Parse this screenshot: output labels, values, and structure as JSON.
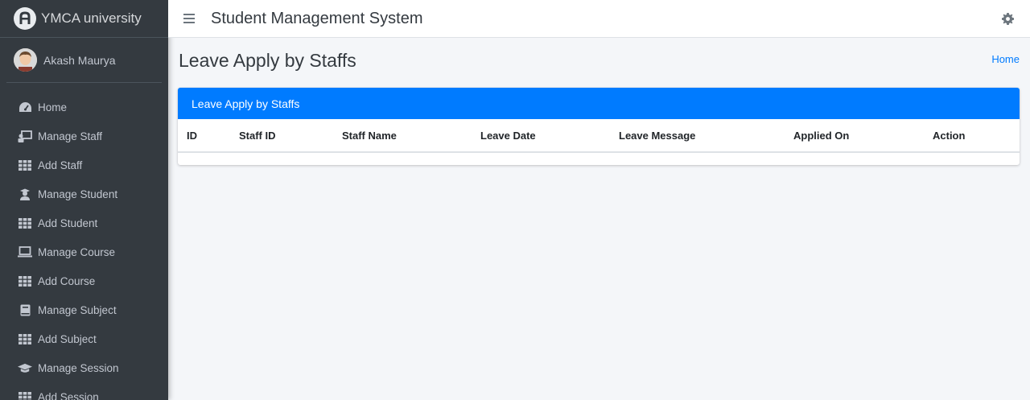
{
  "brand": {
    "name": "YMCA university"
  },
  "user": {
    "name": "Akash Maurya"
  },
  "sidebar": {
    "items": [
      {
        "label": "Home",
        "icon": "tachometer-icon"
      },
      {
        "label": "Manage Staff",
        "icon": "chalkboard-teacher-icon"
      },
      {
        "label": "Add Staff",
        "icon": "grid-icon"
      },
      {
        "label": "Manage Student",
        "icon": "user-graduate-icon"
      },
      {
        "label": "Add Student",
        "icon": "grid-icon"
      },
      {
        "label": "Manage Course",
        "icon": "laptop-icon"
      },
      {
        "label": "Add Course",
        "icon": "grid-icon"
      },
      {
        "label": "Manage Subject",
        "icon": "book-icon"
      },
      {
        "label": "Add Subject",
        "icon": "grid-icon"
      },
      {
        "label": "Manage Session",
        "icon": "graduation-cap-icon"
      },
      {
        "label": "Add Session",
        "icon": "grid-icon"
      }
    ]
  },
  "topbar": {
    "title": "Student Management System"
  },
  "page": {
    "title": "Leave Apply by Staffs",
    "breadcrumb": "Home"
  },
  "card": {
    "title": "Leave Apply by Staffs",
    "columns": [
      "ID",
      "Staff ID",
      "Staff Name",
      "Leave Date",
      "Leave Message",
      "Applied On",
      "Action"
    ]
  },
  "colors": {
    "sidebar_bg": "#343a40",
    "accent": "#007bff",
    "content_bg": "#f4f6f9"
  }
}
